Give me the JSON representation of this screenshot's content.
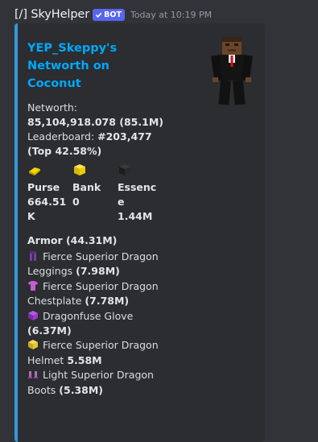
{
  "message": {
    "username": "[/] SkyHelper",
    "bot_tag": "BOT",
    "timestamp": "Today at 10:19 PM"
  },
  "embed": {
    "accent_color": "#3498db",
    "title": "YEP_Skeppy's\nNetworth on\nCoconut",
    "networth_label": "Networth:",
    "networth_value": "85,104,918.078 (85.1M)",
    "leaderboard_label": "Leaderboard: ",
    "leaderboard_rank": "#203,477",
    "leaderboard_top": "(Top 42.58%)",
    "fields": [
      {
        "icon": "gold-ingot-icon",
        "name": "Purse",
        "value": "664.51K"
      },
      {
        "icon": "gold-block-icon",
        "name": "Bank",
        "value": "0"
      },
      {
        "icon": "coal-block-icon",
        "name": "Essence",
        "value": "1.44M"
      }
    ],
    "armor_title": "Armor (44.31M)",
    "armor_items": [
      {
        "icon": "leggings-icon",
        "color": "#7a3f9e",
        "name": "Fierce Superior Dragon Leggings",
        "value": "(7.98M)"
      },
      {
        "icon": "chestplate-icon",
        "color": "#c65cd1",
        "name": "Fierce Superior Dragon Chestplate",
        "value": "(7.78M)"
      },
      {
        "icon": "glove-icon",
        "color": "#9b3fc9",
        "name": "Dragonfuse Glove",
        "value": "(6.37M)"
      },
      {
        "icon": "helmet-icon",
        "color": "#e3c63a",
        "name": "Fierce Superior Dragon Helmet",
        "value": "5.58M"
      },
      {
        "icon": "boots-icon",
        "color": "#b76ab8",
        "name": "Light Superior Dragon Boots",
        "value": "(5.38M)"
      }
    ]
  }
}
